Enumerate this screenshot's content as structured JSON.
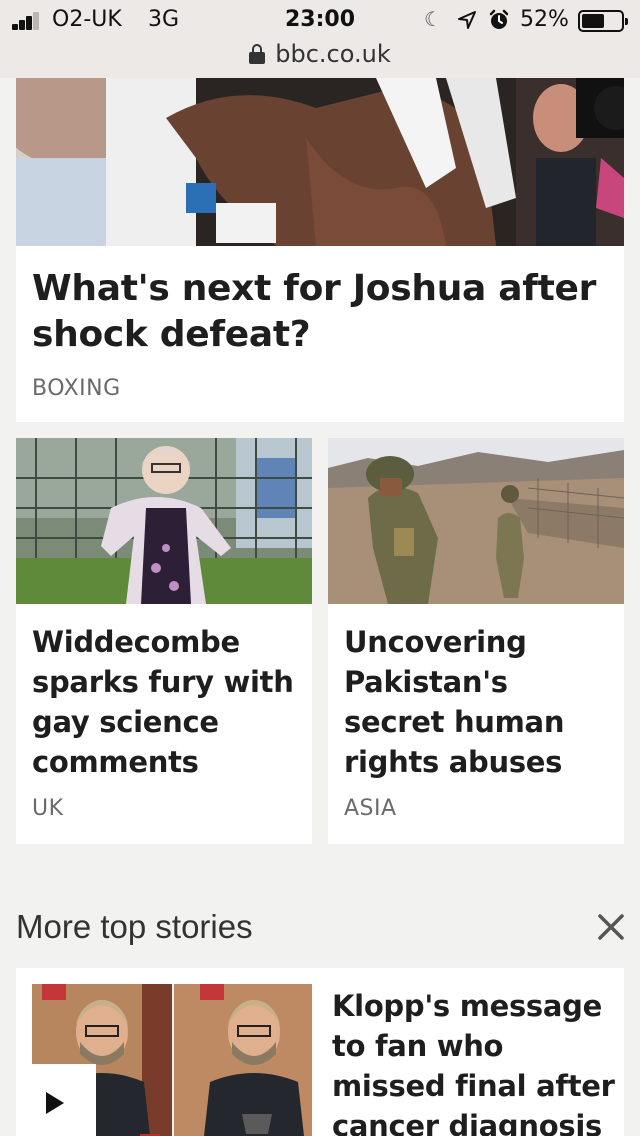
{
  "status_bar": {
    "carrier": "O2-UK",
    "network": "3G",
    "time": "23:00",
    "battery": "52%",
    "battery_level": 0.52,
    "signal_bars": 3,
    "icons": [
      "signal-icon",
      "moon-icon",
      "location-icon",
      "alarm-icon",
      "battery-icon"
    ]
  },
  "address_bar": {
    "url": "bbc.co.uk",
    "icon": "lock-icon"
  },
  "stories": {
    "hero": {
      "headline": "What's next for Joshua after shock defeat?",
      "tag": "BOXING"
    },
    "left": {
      "headline": "Widdecombe sparks fury with gay science comments",
      "tag": "UK"
    },
    "right": {
      "headline": "Uncovering Pakistan's secret human rights abuses",
      "tag": "ASIA"
    }
  },
  "more_top_stories": {
    "title": "More top stories",
    "close_icon": "close-icon",
    "items": [
      {
        "headline": "Klopp's message to fan who missed final after cancer diagnosis",
        "icon": "play-icon"
      }
    ]
  },
  "colors": {
    "page_background": "#f2f2f0",
    "browser_chrome": "#ece9e7",
    "headline": "#1e1e1e",
    "tag": "#6a6a6a"
  }
}
